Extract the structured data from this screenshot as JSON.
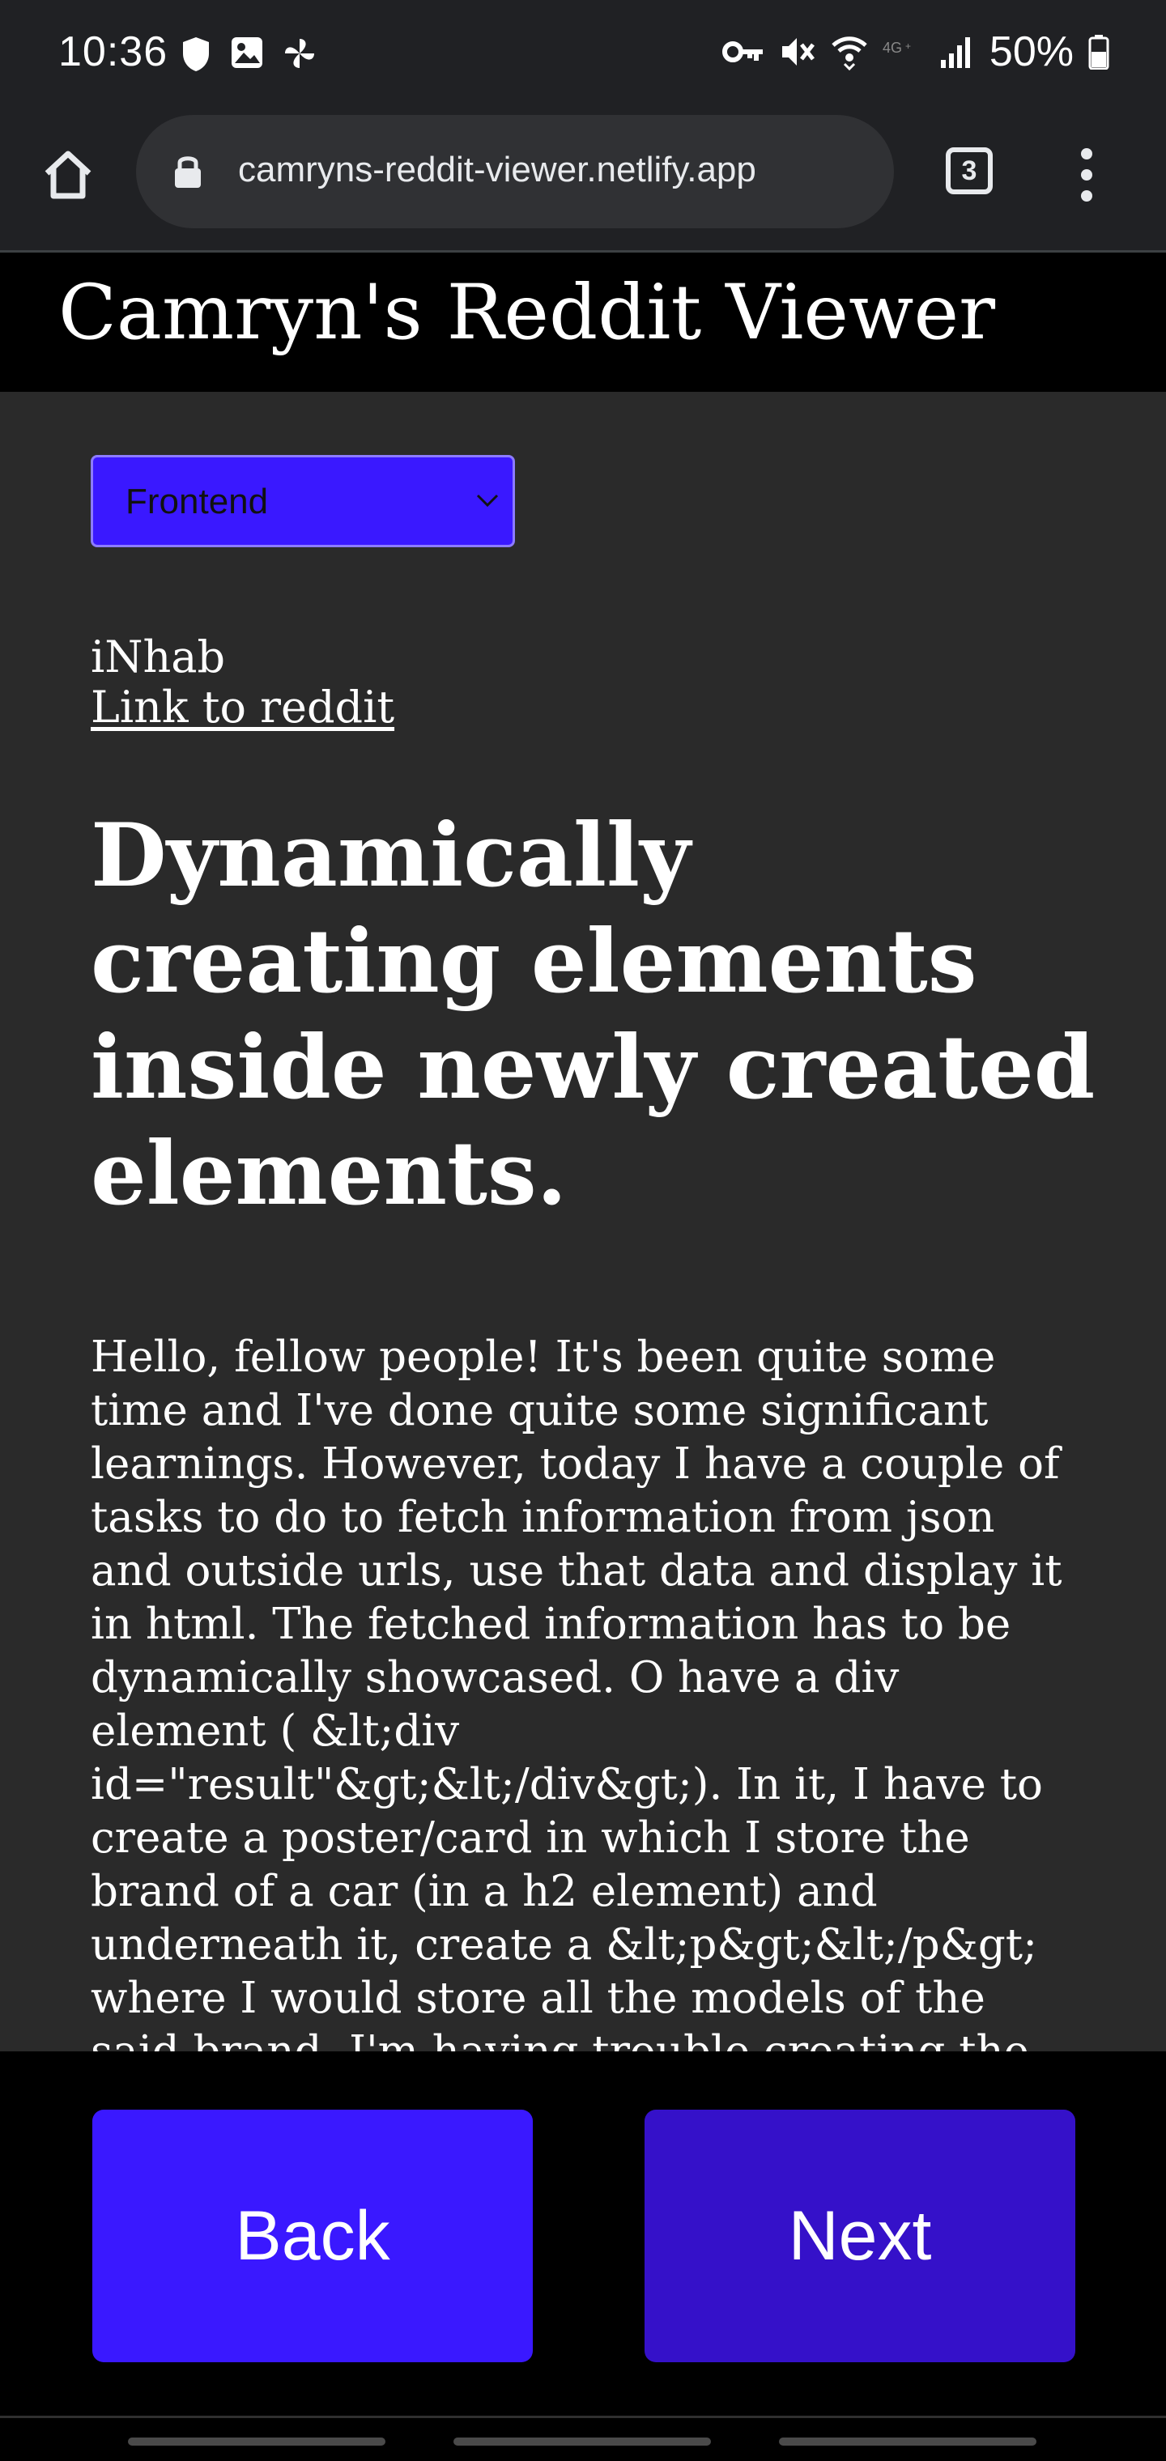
{
  "status_bar": {
    "time": "10:36",
    "battery_percent": "50%",
    "left_icons": [
      "shield-icon",
      "image-icon",
      "pinwheel-icon"
    ],
    "right_icons": [
      "vpn-key-icon",
      "mute-icon",
      "wifi-icon",
      "4g-icon",
      "signal-icon",
      "battery-icon"
    ]
  },
  "browser": {
    "url": "camryns-reddit-viewer.netlify.app",
    "tab_count": "3"
  },
  "site": {
    "title": "Camryn's Reddit Viewer"
  },
  "subreddit_select": {
    "selected": "Frontend"
  },
  "post": {
    "author": "iNhab",
    "link_label": "Link to reddit",
    "title": "Dynamically creating elements inside newly created elements.",
    "body": "Hello, fellow people! It's been quite some time and I've done quite some significant learnings. However, today I have a couple of tasks to do to fetch information from json and outside urls, use that data and display it in html. The fetched information has to be dynamically showcased. O have a div element ( &lt;div id=\"result\"&gt;&lt;/div&gt;). In it, I have to create a poster/card in which I store the brand of a car (in a h2 element) and underneath it, create a &lt;p&gt;&lt;/p&gt; where I would store all the models of the said brand. I'm having trouble creating the whole structure (create new div inside the"
  },
  "nav": {
    "back_label": "Back",
    "next_label": "Next"
  },
  "colors": {
    "accent": "#3a18ff",
    "next_button": "#3511c9",
    "content_bg": "#2a2a2a",
    "chrome_bg": "#202124"
  }
}
